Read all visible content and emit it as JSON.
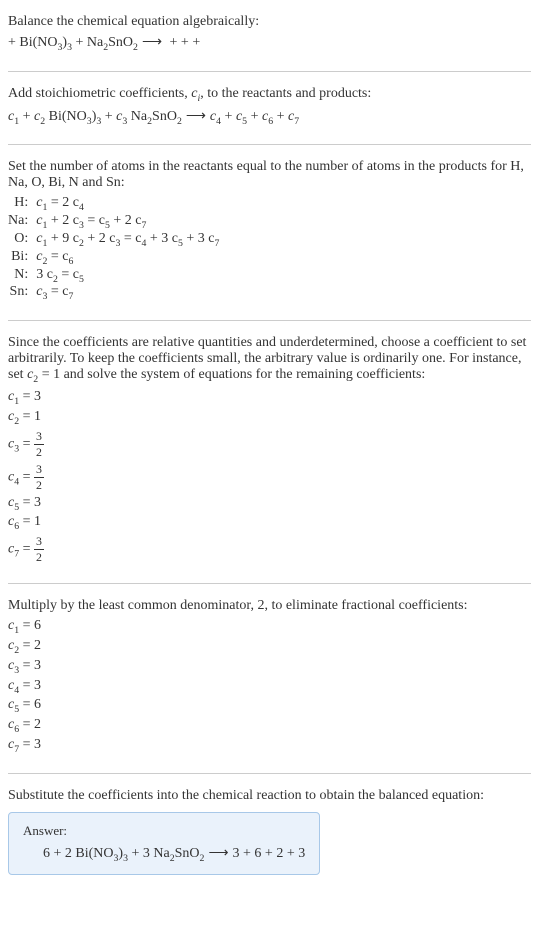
{
  "intro": {
    "line1": "Balance the chemical equation algebraically:",
    "line2_pre": " + Bi(NO",
    "line2_sub1": "3",
    "line2_mid1": ")",
    "line2_sub2": "3",
    "line2_mid2": " + Na",
    "line2_sub3": "2",
    "line2_mid3": "SnO",
    "line2_sub4": "2",
    "line2_arrow": " ⟶ ",
    "line2_post": " +  +  + "
  },
  "stoich": {
    "line1_pre": "Add stoichiometric coefficients, ",
    "line1_ci": "c",
    "line1_ci_sub": "i",
    "line1_post": ", to the reactants and products:",
    "eq_c1": "c",
    "eq_c1_sub": "1",
    "eq_plus1": "  + ",
    "eq_c2": "c",
    "eq_c2_sub": "2",
    "eq_sp1": " Bi(NO",
    "eq_sub1": "3",
    "eq_mid1": ")",
    "eq_sub2": "3",
    "eq_plus2": " + ",
    "eq_c3": "c",
    "eq_c3_sub": "3",
    "eq_sp2": " Na",
    "eq_sub3": "2",
    "eq_mid2": "SnO",
    "eq_sub4": "2",
    "eq_arrow": " ⟶ ",
    "eq_c4": "c",
    "eq_c4_sub": "4",
    "eq_plus3": "  + ",
    "eq_c5": "c",
    "eq_c5_sub": "5",
    "eq_plus4": "  + ",
    "eq_c6": "c",
    "eq_c6_sub": "6",
    "eq_plus5": "  + ",
    "eq_c7": "c",
    "eq_c7_sub": "7"
  },
  "atoms": {
    "intro": "Set the number of atoms in the reactants equal to the number of atoms in the products for H, Na, O, Bi, N and Sn:",
    "rows": {
      "H": {
        "label": "H:",
        "eq_pre": "c",
        "s1": "1",
        "eq_mid": " = 2 c",
        "s2": "4"
      },
      "Na": {
        "label": "Na:",
        "eq_pre": "c",
        "s1": "1",
        "eq_mid1": " + 2 c",
        "s2": "3",
        "eq_mid2": " = c",
        "s3": "5",
        "eq_mid3": " + 2 c",
        "s4": "7"
      },
      "O": {
        "label": "O:",
        "eq_pre": "c",
        "s1": "1",
        "eq_mid1": " + 9 c",
        "s2": "2",
        "eq_mid2": " + 2 c",
        "s3": "3",
        "eq_mid3": " = c",
        "s4": "4",
        "eq_mid4": " + 3 c",
        "s5": "5",
        "eq_mid5": " + 3 c",
        "s6": "7"
      },
      "Bi": {
        "label": "Bi:",
        "eq_pre": "c",
        "s1": "2",
        "eq_mid": " = c",
        "s2": "6"
      },
      "N": {
        "label": "N:",
        "eq_pre": "3 c",
        "s1": "2",
        "eq_mid": " = c",
        "s2": "5"
      },
      "Sn": {
        "label": "Sn:",
        "eq_pre": "c",
        "s1": "3",
        "eq_mid": " = c",
        "s2": "7"
      }
    }
  },
  "solve": {
    "intro_pre": "Since the coefficients are relative quantities and underdetermined, choose a coefficient to set arbitrarily. To keep the coefficients small, the arbitrary value is ordinarily one. For instance, set ",
    "intro_c": "c",
    "intro_csub": "2",
    "intro_post": " = 1 and solve the system of equations for the remaining coefficients:",
    "c1": {
      "pre": "c",
      "sub": "1",
      "val": " = 3"
    },
    "c2": {
      "pre": "c",
      "sub": "2",
      "val": " = 1"
    },
    "c3": {
      "pre": "c",
      "sub": "3",
      "eq": " = ",
      "num": "3",
      "den": "2"
    },
    "c4": {
      "pre": "c",
      "sub": "4",
      "eq": " = ",
      "num": "3",
      "den": "2"
    },
    "c5": {
      "pre": "c",
      "sub": "5",
      "val": " = 3"
    },
    "c6": {
      "pre": "c",
      "sub": "6",
      "val": " = 1"
    },
    "c7": {
      "pre": "c",
      "sub": "7",
      "eq": " = ",
      "num": "3",
      "den": "2"
    }
  },
  "mult": {
    "intro": "Multiply by the least common denominator, 2, to eliminate fractional coefficients:",
    "c1": {
      "pre": "c",
      "sub": "1",
      "val": " = 6"
    },
    "c2": {
      "pre": "c",
      "sub": "2",
      "val": " = 2"
    },
    "c3": {
      "pre": "c",
      "sub": "3",
      "val": " = 3"
    },
    "c4": {
      "pre": "c",
      "sub": "4",
      "val": " = 3"
    },
    "c5": {
      "pre": "c",
      "sub": "5",
      "val": " = 6"
    },
    "c6": {
      "pre": "c",
      "sub": "6",
      "val": " = 2"
    },
    "c7": {
      "pre": "c",
      "sub": "7",
      "val": " = 3"
    }
  },
  "final": {
    "intro": "Substitute the coefficients into the chemical reaction to obtain the balanced equation:",
    "label": "Answer:",
    "eq_pre": "6  + 2 Bi(NO",
    "eq_sub1": "3",
    "eq_mid1": ")",
    "eq_sub2": "3",
    "eq_mid2": " + 3 Na",
    "eq_sub3": "2",
    "eq_mid3": "SnO",
    "eq_sub4": "2",
    "eq_arrow": " ⟶ ",
    "eq_post": "3  + 6  + 2  + 3 "
  }
}
